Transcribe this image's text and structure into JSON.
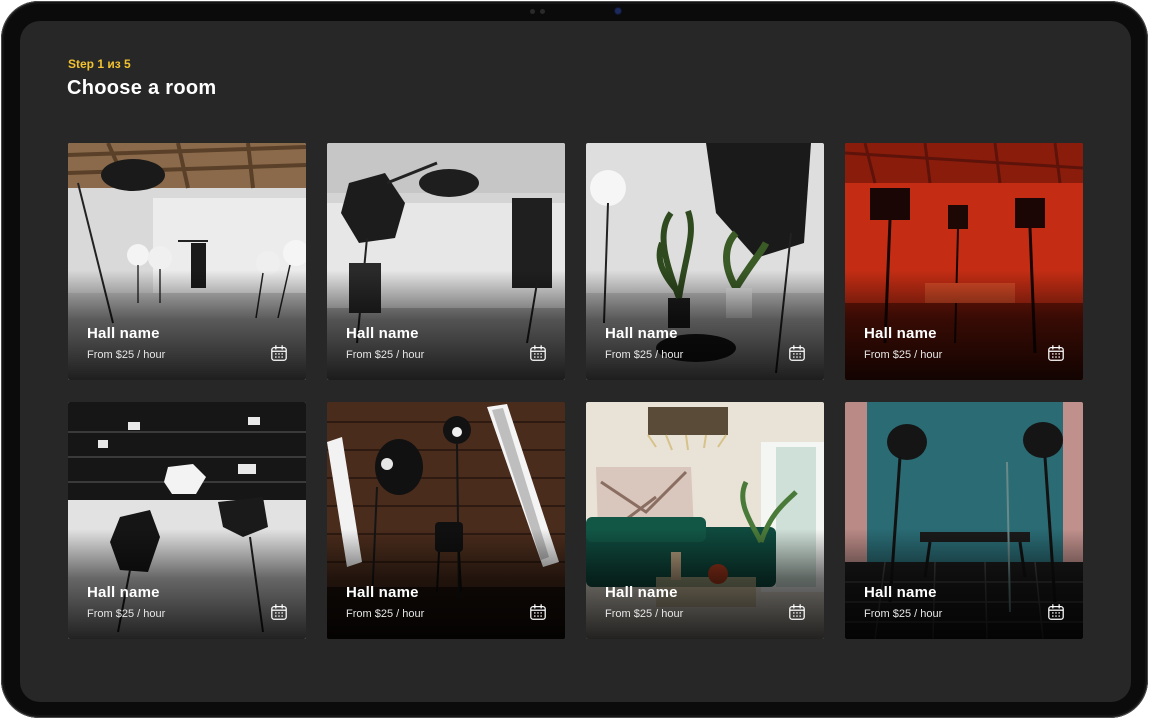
{
  "header": {
    "step": "Step 1 из 5",
    "title": "Choose a room"
  },
  "rooms": [
    {
      "name": "Hall name",
      "price": "From $25 / hour",
      "photo": "studio-white-wood-ceiling"
    },
    {
      "name": "Hall name",
      "price": "From $25 / hour",
      "photo": "studio-white-softboxes"
    },
    {
      "name": "Hall name",
      "price": "From $25 / hour",
      "photo": "studio-white-plants"
    },
    {
      "name": "Hall name",
      "price": "From $25 / hour",
      "photo": "studio-red-light"
    },
    {
      "name": "Hall name",
      "price": "From $25 / hour",
      "photo": "studio-black-rig-ceiling"
    },
    {
      "name": "Hall name",
      "price": "From $25 / hour",
      "photo": "studio-wood-wall"
    },
    {
      "name": "Hall name",
      "price": "From $25 / hour",
      "photo": "living-room-green-sofa"
    },
    {
      "name": "Hall name",
      "price": "From $25 / hour",
      "photo": "studio-teal-wall"
    }
  ],
  "colors": {
    "accent": "#f2c230",
    "background": "#272727",
    "text": "#ffffff"
  },
  "icons": {
    "book": "calendar-icon"
  }
}
